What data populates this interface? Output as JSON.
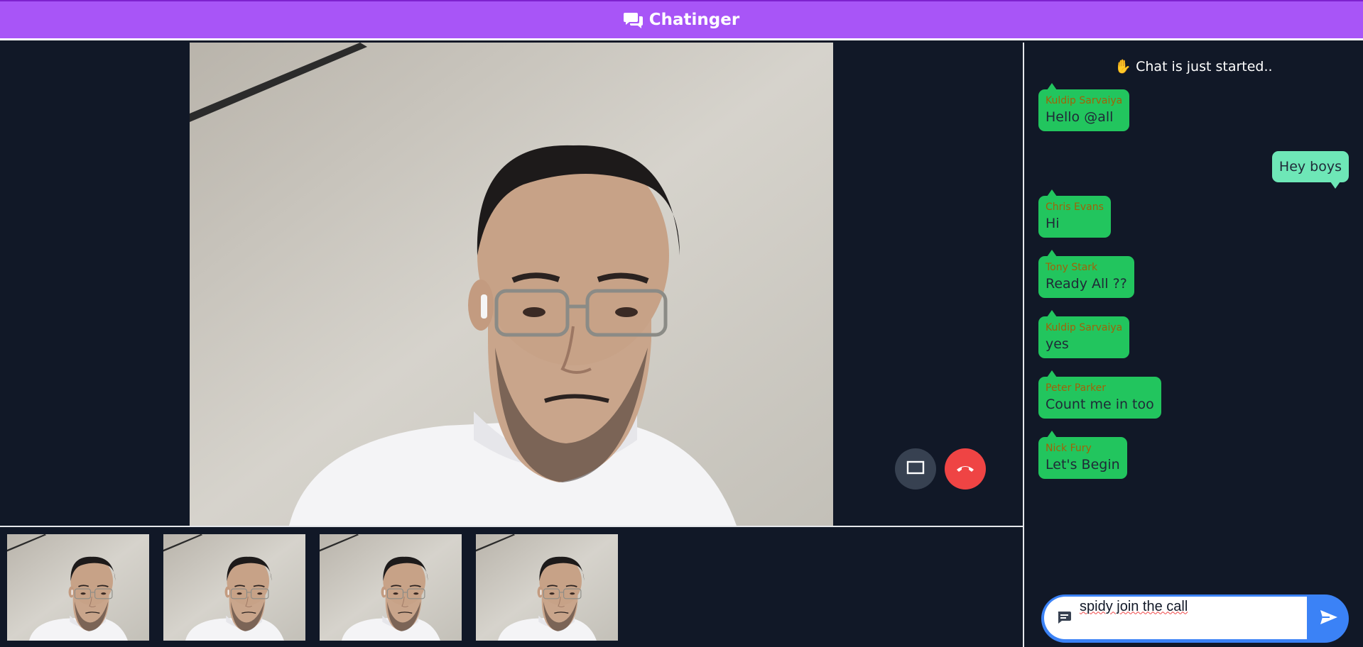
{
  "header": {
    "brand": "Chatinger",
    "icon": "chat-bubbles-icon"
  },
  "controls": {
    "screen_share_icon": "screen-icon",
    "hangup_icon": "phone-hangup-icon"
  },
  "chat": {
    "start_notice": "✋ Chat is just started..",
    "messages": [
      {
        "sender": "Kuldip Sarvaiya",
        "text": "Hello @all",
        "mine": false
      },
      {
        "sender": "",
        "text": "Hey boys",
        "mine": true
      },
      {
        "sender": "Chris Evans",
        "text": "Hi",
        "mine": false
      },
      {
        "sender": "Tony Stark",
        "text": "Ready All ??",
        "mine": false
      },
      {
        "sender": "Kuldip Sarvaiya",
        "text": "yes",
        "mine": false
      },
      {
        "sender": "Peter Parker",
        "text": "Count me in too",
        "mine": false
      },
      {
        "sender": "Nick Fury",
        "text": "Let's Begin",
        "mine": false
      }
    ],
    "input_value": "spidy join the call"
  },
  "colors": {
    "header": "#a855f7",
    "background": "#111827",
    "message": "#22c55e",
    "my_message": "#6ee7b7",
    "hangup": "#ef4444",
    "send": "#3b82f6"
  }
}
